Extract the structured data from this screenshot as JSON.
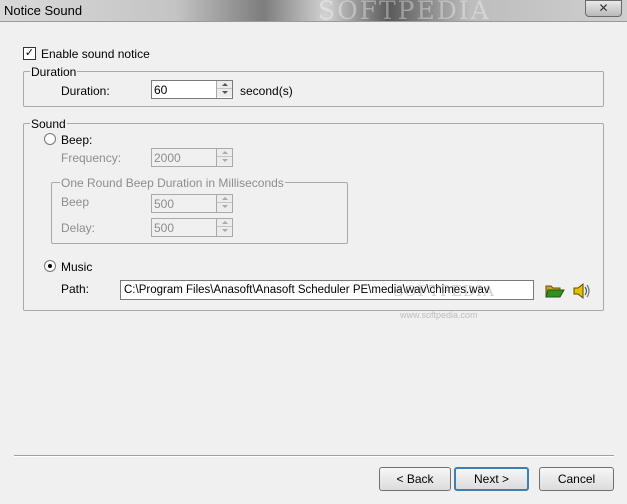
{
  "window": {
    "title": "Notice Sound",
    "watermark": "SOFTPEDIA",
    "close_label": "✕"
  },
  "enable": {
    "checked": true,
    "label": "Enable sound notice"
  },
  "duration": {
    "legend": "Duration",
    "label": "Duration:",
    "value": "60",
    "unit": "second(s)"
  },
  "sound": {
    "legend": "Sound",
    "beep": {
      "label": "Beep:",
      "selected": false,
      "frequency_label": "Frequency:",
      "frequency_value": "2000",
      "duration_group": {
        "legend": "One Round Beep Duration in Milliseconds",
        "beep_label": "Beep",
        "beep_value": "500",
        "delay_label": "Delay:",
        "delay_value": "500"
      }
    },
    "music": {
      "label": "Music",
      "selected": true,
      "path_label": "Path:",
      "path_value": "C:\\Program Files\\Anasoft\\Anasoft Scheduler PE\\media\\wav\\chimes.wav",
      "path_watermark": "SOFTPEDIA",
      "url_watermark": "www.softpedia.com",
      "icons": [
        "open-folder-icon",
        "speaker-icon"
      ]
    }
  },
  "footer": {
    "back_label": "< Back",
    "next_label": "Next >",
    "cancel_label": "Cancel"
  }
}
